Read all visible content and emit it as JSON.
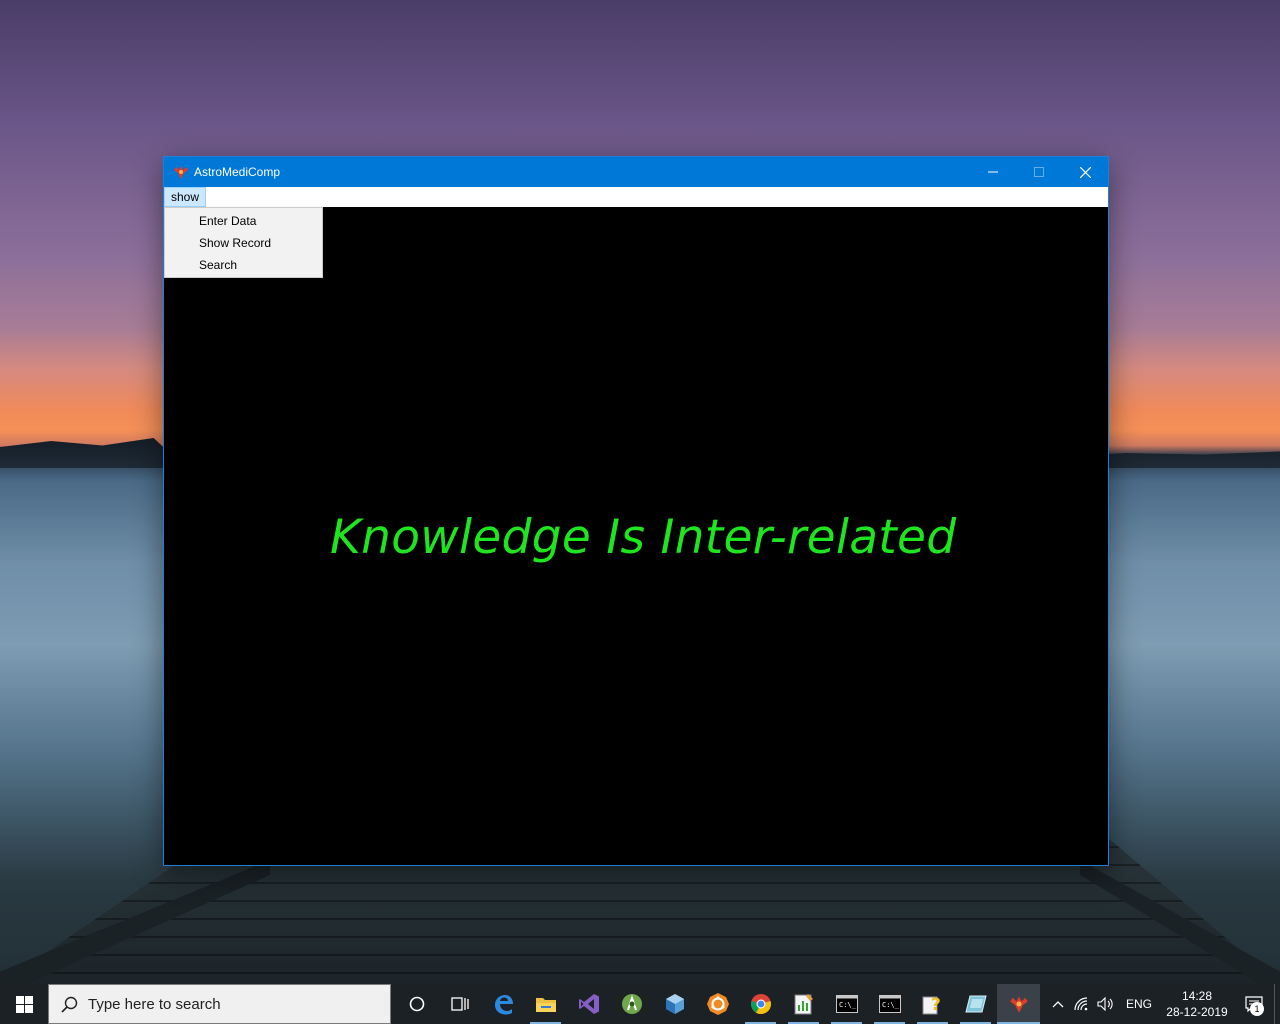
{
  "window": {
    "title": "AstroMediComp",
    "menu": {
      "items": [
        {
          "label": "show"
        }
      ],
      "dropdown": [
        {
          "label": "Enter Data"
        },
        {
          "label": "Show Record"
        },
        {
          "label": "Search"
        }
      ]
    },
    "content": {
      "motto": "Knowledge Is Inter-related",
      "motto_color": "#1ee61e"
    },
    "controls": [
      "minimize-icon",
      "maximize-icon",
      "close-icon"
    ]
  },
  "taskbar": {
    "search_placeholder": "Type here to search",
    "pinned": [
      "cortana-icon",
      "task-view-icon",
      "edge-icon",
      "file-explorer-icon",
      "visual-studio-icon",
      "android-studio-icon",
      "virtualbox-icon",
      "ubuntu-icon",
      "chrome-icon",
      "notepad-chart-icon",
      "cmd-icon",
      "cmd-icon-2",
      "help-icon",
      "sticky-app-icon",
      "astromedicomp-icon"
    ],
    "tray": {
      "language": "ENG",
      "time": "14:28",
      "date": "28-12-2019",
      "notifications": "1"
    }
  },
  "colors": {
    "titlebar": "#0078d7",
    "taskbar": "#1c2126",
    "menu_highlight": "#cce8ff"
  }
}
